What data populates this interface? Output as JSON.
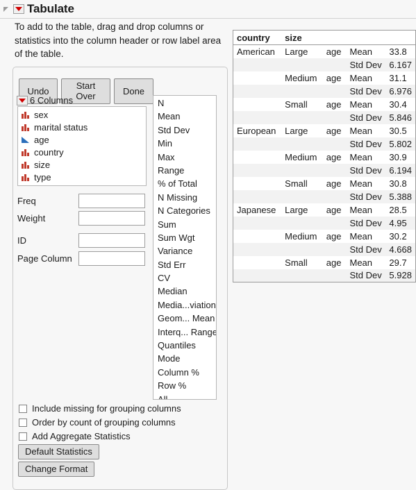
{
  "window": {
    "title": "Tabulate",
    "disclosure_icon": "disclosure-triangle-icon",
    "menu_icon": "red-dropdown-icon"
  },
  "instructions": "To add to the table, drag and drop columns or statistics into the column header or row label area of the table.",
  "toolbar": {
    "undo_label": "Undo",
    "start_over_label": "Start Over",
    "done_label": "Done"
  },
  "columns_panel": {
    "header_label": "6 Columns",
    "header_menu_icon": "red-dropdown-icon",
    "items": [
      {
        "label": "sex",
        "type": "nominal"
      },
      {
        "label": "marital status",
        "type": "nominal"
      },
      {
        "label": "age",
        "type": "continuous"
      },
      {
        "label": "country",
        "type": "nominal"
      },
      {
        "label": "size",
        "type": "nominal"
      },
      {
        "label": "type",
        "type": "nominal"
      }
    ]
  },
  "roles": [
    {
      "label": "Freq",
      "value": ""
    },
    {
      "label": "Weight",
      "value": ""
    },
    {
      "label": "ID",
      "value": ""
    },
    {
      "label": "Page Column",
      "value": ""
    }
  ],
  "statistics": [
    "N",
    "Mean",
    "Std Dev",
    "Min",
    "Max",
    "Range",
    "% of Total",
    "N Missing",
    "N Categories",
    "Sum",
    "Sum Wgt",
    "Variance",
    "Std Err",
    "CV",
    "Median",
    "Media...viation",
    "Geom... Mean",
    "Interq... Range",
    "Quantiles",
    "Mode",
    "Column %",
    "Row %",
    "All"
  ],
  "options": [
    {
      "label": "Include missing for grouping columns",
      "checked": false
    },
    {
      "label": "Order by count of grouping columns",
      "checked": false
    },
    {
      "label": "Add Aggregate Statistics",
      "checked": false
    }
  ],
  "bottom_buttons": {
    "default_statistics_label": "Default Statistics",
    "change_format_label": "Change Format"
  },
  "output_table": {
    "headers": [
      "country",
      "size",
      "",
      "",
      ""
    ],
    "rows": [
      {
        "country": "American",
        "size": "Large",
        "variable": "age",
        "statistic": "Mean",
        "value": "33.8",
        "alt": false
      },
      {
        "country": "",
        "size": "",
        "variable": "",
        "statistic": "Std Dev",
        "value": "6.167",
        "alt": true
      },
      {
        "country": "",
        "size": "Medium",
        "variable": "age",
        "statistic": "Mean",
        "value": "31.1",
        "alt": false
      },
      {
        "country": "",
        "size": "",
        "variable": "",
        "statistic": "Std Dev",
        "value": "6.976",
        "alt": true
      },
      {
        "country": "",
        "size": "Small",
        "variable": "age",
        "statistic": "Mean",
        "value": "30.4",
        "alt": false
      },
      {
        "country": "",
        "size": "",
        "variable": "",
        "statistic": "Std Dev",
        "value": "5.846",
        "alt": true
      },
      {
        "country": "European",
        "size": "Large",
        "variable": "age",
        "statistic": "Mean",
        "value": "30.5",
        "alt": false
      },
      {
        "country": "",
        "size": "",
        "variable": "",
        "statistic": "Std Dev",
        "value": "5.802",
        "alt": true
      },
      {
        "country": "",
        "size": "Medium",
        "variable": "age",
        "statistic": "Mean",
        "value": "30.9",
        "alt": false
      },
      {
        "country": "",
        "size": "",
        "variable": "",
        "statistic": "Std Dev",
        "value": "6.194",
        "alt": true
      },
      {
        "country": "",
        "size": "Small",
        "variable": "age",
        "statistic": "Mean",
        "value": "30.8",
        "alt": false
      },
      {
        "country": "",
        "size": "",
        "variable": "",
        "statistic": "Std Dev",
        "value": "5.388",
        "alt": true
      },
      {
        "country": "Japanese",
        "size": "Large",
        "variable": "age",
        "statistic": "Mean",
        "value": "28.5",
        "alt": false
      },
      {
        "country": "",
        "size": "",
        "variable": "",
        "statistic": "Std Dev",
        "value": "4.95",
        "alt": true
      },
      {
        "country": "",
        "size": "Medium",
        "variable": "age",
        "statistic": "Mean",
        "value": "30.2",
        "alt": false
      },
      {
        "country": "",
        "size": "",
        "variable": "",
        "statistic": "Std Dev",
        "value": "4.668",
        "alt": true
      },
      {
        "country": "",
        "size": "Small",
        "variable": "age",
        "statistic": "Mean",
        "value": "29.7",
        "alt": false
      },
      {
        "country": "",
        "size": "",
        "variable": "",
        "statistic": "Std Dev",
        "value": "5.928",
        "alt": true
      }
    ]
  }
}
